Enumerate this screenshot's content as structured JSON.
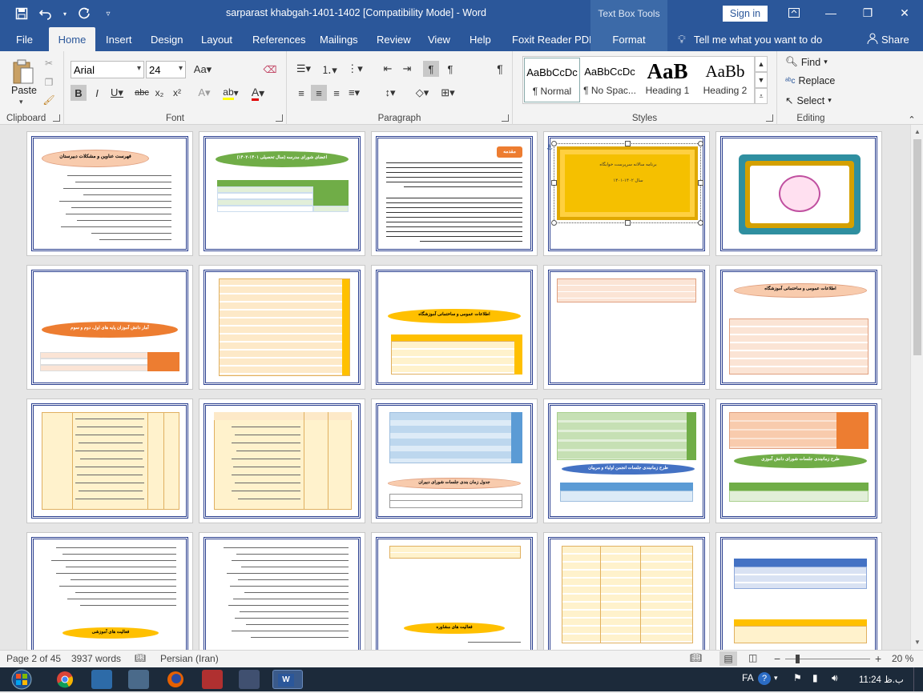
{
  "window": {
    "title": "sarparast khabgah-1401-1402 [Compatibility Mode]  -  Word",
    "context_tab": "Text Box Tools",
    "signin": "Sign in"
  },
  "tabs": [
    "File",
    "Home",
    "Insert",
    "Design",
    "Layout",
    "References",
    "Mailings",
    "Review",
    "View",
    "Help",
    "Foxit Reader PDF",
    "Format"
  ],
  "tellme": "Tell me what you want to do",
  "share": "Share",
  "ribbon": {
    "clipboard": {
      "label": "Clipboard",
      "paste": "Paste"
    },
    "font": {
      "label": "Font",
      "name": "Arial",
      "size": "24"
    },
    "paragraph": {
      "label": "Paragraph"
    },
    "styles": {
      "label": "Styles",
      "items": [
        {
          "preview": "AaBbCcDc",
          "name": "¶ Normal"
        },
        {
          "preview": "AaBbCcDc",
          "name": "¶ No Spac..."
        },
        {
          "preview": "AaB",
          "name": "Heading 1"
        },
        {
          "preview": "AaBb",
          "name": "Heading 2"
        }
      ]
    },
    "editing": {
      "label": "Editing",
      "find": "Find",
      "replace": "Replace",
      "select": "Select"
    }
  },
  "pages": {
    "p1_title": "فهرست عناوین و مشکلات دبیرستان",
    "p2_title": "اعضای شورای مدرسه (سال تحصیلی ۱۴۰۱-۱۴۰۲)",
    "p3_title": "مقدمه",
    "p4_line1": "برنامه سالانه سرپرست خوابگاه",
    "p4_line2": "سال ۱۴۰۲-۱۴۰۱",
    "p6_title": "آمار دانش آموزان پایه های اول، دوم و سوم",
    "p8_title": "اطلاعات عمومی و ساختمانی آموزشگاه",
    "p10_title": "اطلاعات عمومی و ساختمانی آموزشگاه",
    "p13_title": "جدول زمان بندی جلسات شورای دبیران",
    "p14_title": "طرح زمانبندی جلسات انجمن اولیاء و مربیان",
    "p15_title": "طرح زمانبندی جلسات شورای دانش آموزی",
    "p16_title": "فعالیت های آموزشی",
    "p18_title": "فعالیت های مشاوره"
  },
  "status": {
    "page": "Page 2 of 45",
    "words": "3937 words",
    "language": "Persian (Iran)",
    "zoom": "20 %"
  },
  "taskbar": {
    "lang": "FA",
    "time": "11:24 ب.ظ"
  },
  "colors": {
    "word_blue": "#2b579a",
    "orange": "#ed7d31",
    "green": "#70ad47",
    "yellow": "#ffc000",
    "peach": "#f8cbad",
    "frame": "#2a3f8f"
  }
}
